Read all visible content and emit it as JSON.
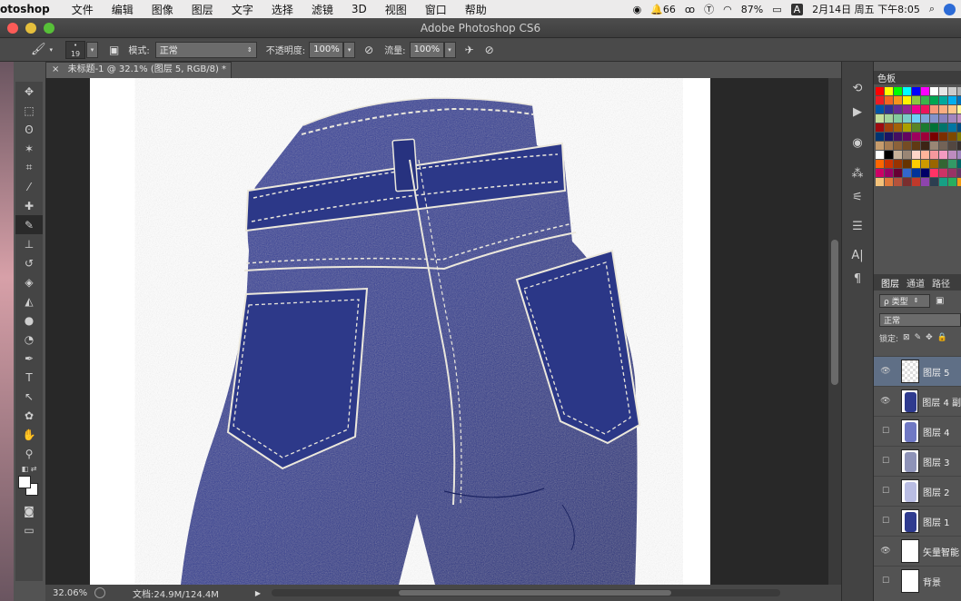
{
  "menubar": {
    "app": "otoshop",
    "items": [
      "文件",
      "编辑",
      "图像",
      "图层",
      "文字",
      "选择",
      "滤镜",
      "3D",
      "视图",
      "窗口",
      "帮助"
    ],
    "battery": "87%",
    "notif_count": "66",
    "datetime": "2月14日 周五 下午8:05",
    "input_method": "A"
  },
  "window": {
    "title": "Adobe Photoshop CS6"
  },
  "options": {
    "brush_size": "19",
    "mode_label": "模式:",
    "mode_value": "正常",
    "opacity_label": "不透明度:",
    "opacity_value": "100%",
    "flow_label": "流量:",
    "flow_value": "100%"
  },
  "document": {
    "tab_title": "未标题-1 @ 32.1% (图层 5, RGB/8) *",
    "zoom": "32.06%",
    "doc_size": "文档:24.9M/124.4M"
  },
  "swatches": {
    "title": "色板"
  },
  "layers_panel": {
    "tabs": [
      "图层",
      "通道",
      "路径"
    ],
    "filter_label": "ρ 类型",
    "blend_mode": "正常",
    "lock_label": "锁定:",
    "layers": [
      {
        "name": "图层 5",
        "visible": true,
        "selected": true
      },
      {
        "name": "图层 4 副",
        "visible": true,
        "selected": false
      },
      {
        "name": "图层 4",
        "visible": false,
        "selected": false
      },
      {
        "name": "图层 3",
        "visible": false,
        "selected": false
      },
      {
        "name": "图层 2",
        "visible": false,
        "selected": false
      },
      {
        "name": "图层 1",
        "visible": false,
        "selected": false
      },
      {
        "name": "矢量智能",
        "visible": true,
        "selected": false
      },
      {
        "name": "背景",
        "visible": false,
        "selected": false
      }
    ]
  },
  "colors": {
    "denim": "#2f3b8f",
    "denim_dark": "#232c72",
    "stitch": "#e9e6dc"
  }
}
